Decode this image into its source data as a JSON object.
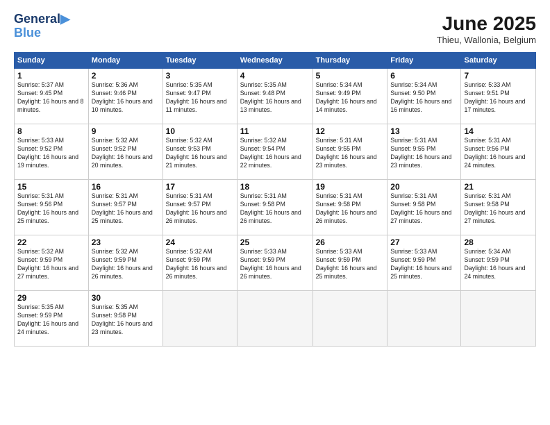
{
  "header": {
    "logo_line1": "General",
    "logo_line2": "Blue",
    "month_year": "June 2025",
    "location": "Thieu, Wallonia, Belgium"
  },
  "days_of_week": [
    "Sunday",
    "Monday",
    "Tuesday",
    "Wednesday",
    "Thursday",
    "Friday",
    "Saturday"
  ],
  "weeks": [
    [
      {
        "day": "1",
        "sunrise": "Sunrise: 5:37 AM",
        "sunset": "Sunset: 9:45 PM",
        "daylight": "Daylight: 16 hours and 8 minutes."
      },
      {
        "day": "2",
        "sunrise": "Sunrise: 5:36 AM",
        "sunset": "Sunset: 9:46 PM",
        "daylight": "Daylight: 16 hours and 10 minutes."
      },
      {
        "day": "3",
        "sunrise": "Sunrise: 5:35 AM",
        "sunset": "Sunset: 9:47 PM",
        "daylight": "Daylight: 16 hours and 11 minutes."
      },
      {
        "day": "4",
        "sunrise": "Sunrise: 5:35 AM",
        "sunset": "Sunset: 9:48 PM",
        "daylight": "Daylight: 16 hours and 13 minutes."
      },
      {
        "day": "5",
        "sunrise": "Sunrise: 5:34 AM",
        "sunset": "Sunset: 9:49 PM",
        "daylight": "Daylight: 16 hours and 14 minutes."
      },
      {
        "day": "6",
        "sunrise": "Sunrise: 5:34 AM",
        "sunset": "Sunset: 9:50 PM",
        "daylight": "Daylight: 16 hours and 16 minutes."
      },
      {
        "day": "7",
        "sunrise": "Sunrise: 5:33 AM",
        "sunset": "Sunset: 9:51 PM",
        "daylight": "Daylight: 16 hours and 17 minutes."
      }
    ],
    [
      {
        "day": "8",
        "sunrise": "Sunrise: 5:33 AM",
        "sunset": "Sunset: 9:52 PM",
        "daylight": "Daylight: 16 hours and 19 minutes."
      },
      {
        "day": "9",
        "sunrise": "Sunrise: 5:32 AM",
        "sunset": "Sunset: 9:52 PM",
        "daylight": "Daylight: 16 hours and 20 minutes."
      },
      {
        "day": "10",
        "sunrise": "Sunrise: 5:32 AM",
        "sunset": "Sunset: 9:53 PM",
        "daylight": "Daylight: 16 hours and 21 minutes."
      },
      {
        "day": "11",
        "sunrise": "Sunrise: 5:32 AM",
        "sunset": "Sunset: 9:54 PM",
        "daylight": "Daylight: 16 hours and 22 minutes."
      },
      {
        "day": "12",
        "sunrise": "Sunrise: 5:31 AM",
        "sunset": "Sunset: 9:55 PM",
        "daylight": "Daylight: 16 hours and 23 minutes."
      },
      {
        "day": "13",
        "sunrise": "Sunrise: 5:31 AM",
        "sunset": "Sunset: 9:55 PM",
        "daylight": "Daylight: 16 hours and 23 minutes."
      },
      {
        "day": "14",
        "sunrise": "Sunrise: 5:31 AM",
        "sunset": "Sunset: 9:56 PM",
        "daylight": "Daylight: 16 hours and 24 minutes."
      }
    ],
    [
      {
        "day": "15",
        "sunrise": "Sunrise: 5:31 AM",
        "sunset": "Sunset: 9:56 PM",
        "daylight": "Daylight: 16 hours and 25 minutes."
      },
      {
        "day": "16",
        "sunrise": "Sunrise: 5:31 AM",
        "sunset": "Sunset: 9:57 PM",
        "daylight": "Daylight: 16 hours and 25 minutes."
      },
      {
        "day": "17",
        "sunrise": "Sunrise: 5:31 AM",
        "sunset": "Sunset: 9:57 PM",
        "daylight": "Daylight: 16 hours and 26 minutes."
      },
      {
        "day": "18",
        "sunrise": "Sunrise: 5:31 AM",
        "sunset": "Sunset: 9:58 PM",
        "daylight": "Daylight: 16 hours and 26 minutes."
      },
      {
        "day": "19",
        "sunrise": "Sunrise: 5:31 AM",
        "sunset": "Sunset: 9:58 PM",
        "daylight": "Daylight: 16 hours and 26 minutes."
      },
      {
        "day": "20",
        "sunrise": "Sunrise: 5:31 AM",
        "sunset": "Sunset: 9:58 PM",
        "daylight": "Daylight: 16 hours and 27 minutes."
      },
      {
        "day": "21",
        "sunrise": "Sunrise: 5:31 AM",
        "sunset": "Sunset: 9:58 PM",
        "daylight": "Daylight: 16 hours and 27 minutes."
      }
    ],
    [
      {
        "day": "22",
        "sunrise": "Sunrise: 5:32 AM",
        "sunset": "Sunset: 9:59 PM",
        "daylight": "Daylight: 16 hours and 27 minutes."
      },
      {
        "day": "23",
        "sunrise": "Sunrise: 5:32 AM",
        "sunset": "Sunset: 9:59 PM",
        "daylight": "Daylight: 16 hours and 26 minutes."
      },
      {
        "day": "24",
        "sunrise": "Sunrise: 5:32 AM",
        "sunset": "Sunset: 9:59 PM",
        "daylight": "Daylight: 16 hours and 26 minutes."
      },
      {
        "day": "25",
        "sunrise": "Sunrise: 5:33 AM",
        "sunset": "Sunset: 9:59 PM",
        "daylight": "Daylight: 16 hours and 26 minutes."
      },
      {
        "day": "26",
        "sunrise": "Sunrise: 5:33 AM",
        "sunset": "Sunset: 9:59 PM",
        "daylight": "Daylight: 16 hours and 25 minutes."
      },
      {
        "day": "27",
        "sunrise": "Sunrise: 5:33 AM",
        "sunset": "Sunset: 9:59 PM",
        "daylight": "Daylight: 16 hours and 25 minutes."
      },
      {
        "day": "28",
        "sunrise": "Sunrise: 5:34 AM",
        "sunset": "Sunset: 9:59 PM",
        "daylight": "Daylight: 16 hours and 24 minutes."
      }
    ],
    [
      {
        "day": "29",
        "sunrise": "Sunrise: 5:35 AM",
        "sunset": "Sunset: 9:59 PM",
        "daylight": "Daylight: 16 hours and 24 minutes."
      },
      {
        "day": "30",
        "sunrise": "Sunrise: 5:35 AM",
        "sunset": "Sunset: 9:58 PM",
        "daylight": "Daylight: 16 hours and 23 minutes."
      },
      null,
      null,
      null,
      null,
      null
    ]
  ]
}
